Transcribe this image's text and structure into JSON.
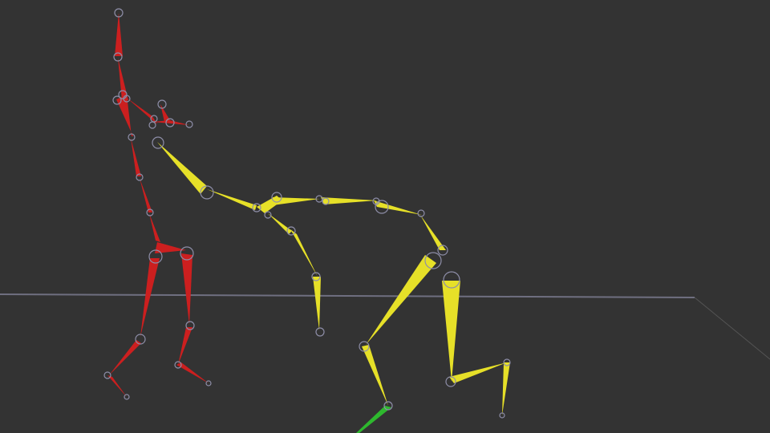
{
  "viewport": {
    "background": "#333333",
    "ground_line_color": "#6f6f80",
    "joint_color": "#8e8ea8"
  },
  "skeletons": [
    {
      "name": "red-skeleton",
      "color": "#cc1f1f"
    },
    {
      "name": "yellow-skeleton",
      "color": "#e6e028"
    },
    {
      "name": "green-bone",
      "color": "#2eb82e"
    }
  ]
}
